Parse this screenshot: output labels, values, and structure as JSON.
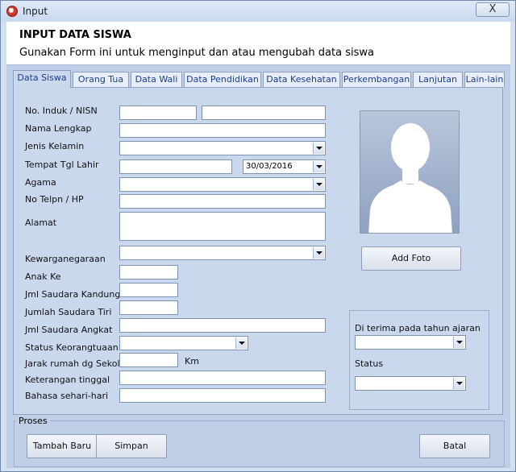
{
  "window": {
    "title": "Input",
    "close_label": "X"
  },
  "header": {
    "title": "INPUT DATA SISWA",
    "subtitle": "Gunakan Form ini untuk menginput dan atau mengubah data siswa"
  },
  "tabs": [
    "Data Siswa",
    "Orang Tua",
    "Data Wali",
    "Data Pendidikan",
    "Data Kesehatan",
    "Perkembangan",
    "Lanjutan",
    "Lain-lain"
  ],
  "form": {
    "labels": {
      "nisn": "No. Induk / NISN",
      "nama": "Nama Lengkap",
      "jenis_kelamin": "Jenis Kelamin",
      "ttl": "Tempat Tgl Lahir",
      "agama": "Agama",
      "telp": "No Telpn / HP",
      "alamat": "Alamat",
      "kewarganegaraan": "Kewarganegaraan",
      "anak_ke": "Anak Ke",
      "saudara_kandung": "Jml Saudara Kandung",
      "saudara_tiri": "Jumlah Saudara Tiri",
      "saudara_angkat": "Jml Saudara Angkat",
      "status_keorangtuaan": "Status Keorangtuaan",
      "jarak": "Jarak rumah dg Sekolah",
      "jarak_unit": "Km",
      "keterangan": "Keterangan tinggal",
      "bahasa": "Bahasa sehari-hari"
    },
    "values": {
      "tanggal_lahir": "30/03/2016"
    }
  },
  "photo": {
    "add_label": "Add Foto"
  },
  "penerimaan": {
    "tahun_label": "Di terima pada tahun ajaran",
    "status_label": "Status"
  },
  "proses": {
    "label": "Proses",
    "tambah": "Tambah Baru",
    "simpan": "Simpan",
    "batal": "Batal"
  }
}
